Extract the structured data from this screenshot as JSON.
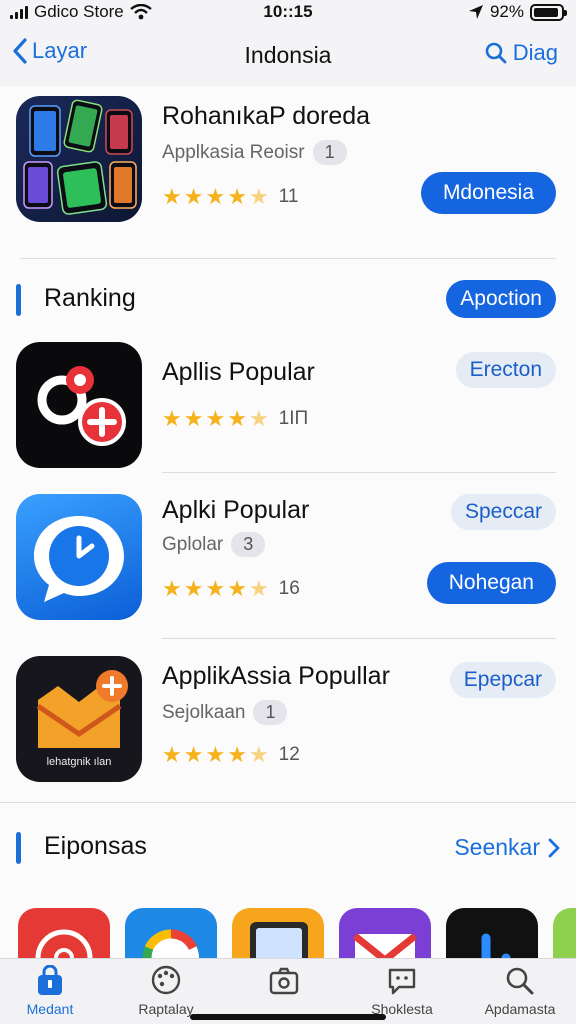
{
  "status": {
    "carrier": "Gdico Store",
    "time": "10::15",
    "battery": "92%",
    "battery_level": 0.92
  },
  "nav": {
    "back_label": "Layar",
    "title": "Indonsia",
    "search_label": "Diag"
  },
  "featured": {
    "name": "RohanıkaP doreda",
    "subtitle": "Applkasia Reoisr",
    "badge": "1",
    "rating_count": "11",
    "button": "Mdonesia"
  },
  "ranking": {
    "title": "Ranking",
    "button": "Apoction",
    "apps": [
      {
        "name": "Apllis Popular",
        "subtitle": "",
        "badge": "",
        "rating_count": "1ΙΠ",
        "tag": "Erecton",
        "button": ""
      },
      {
        "name": "Aplki Popular",
        "subtitle": "Gplolar",
        "badge": "3",
        "rating_count": "16",
        "tag": "Speccar",
        "button": "Nohegan"
      },
      {
        "name": "ApplikAssia Popullar",
        "subtitle": "Sejolkaan",
        "badge": "1",
        "rating_count": "12",
        "tag": "Epepcar",
        "button": "",
        "icon_caption": "lehatgnik ılan"
      }
    ]
  },
  "eiponsas": {
    "title": "Eiponsas",
    "link": "Seenkar"
  },
  "tabs": [
    {
      "label": "Medant",
      "icon": "bag-icon",
      "active": true
    },
    {
      "label": "Raptalay",
      "icon": "palette-icon",
      "active": false
    },
    {
      "label": "",
      "icon": "camera-icon",
      "active": false
    },
    {
      "label": "Shoklesta",
      "icon": "chat-icon",
      "active": false
    },
    {
      "label": "Apdamasta",
      "icon": "search-icon",
      "active": false
    }
  ],
  "colors": {
    "accent": "#1a6fdb",
    "button": "#1565e0",
    "star": "#f6b21a"
  }
}
